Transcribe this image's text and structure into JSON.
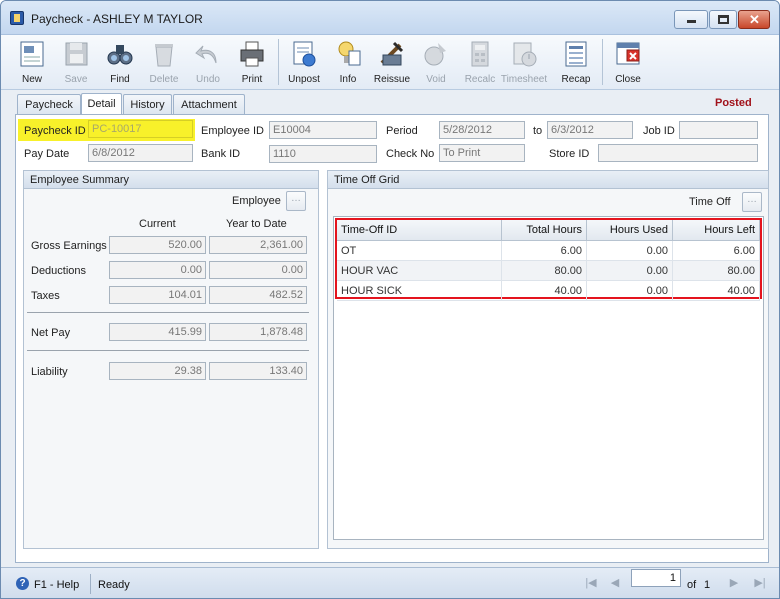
{
  "window": {
    "title": "Paycheck - ASHLEY M TAYLOR",
    "status": "Posted"
  },
  "toolbar": {
    "new": "New",
    "save": "Save",
    "find": "Find",
    "delete": "Delete",
    "undo": "Undo",
    "print": "Print",
    "unpost": "Unpost",
    "info": "Info",
    "reissue": "Reissue",
    "void": "Void",
    "recalc": "Recalc",
    "timesheet": "Timesheet",
    "recap": "Recap",
    "close": "Close"
  },
  "tabs": [
    "Paycheck",
    "Detail",
    "History",
    "Attachment"
  ],
  "header": {
    "paycheck_id_label": "Paycheck ID",
    "paycheck_id": "PC-10017",
    "employee_id_label": "Employee ID",
    "employee_id": "E10004",
    "period_label": "Period",
    "period_start": "5/28/2012",
    "to_label": "to",
    "period_end": "6/3/2012",
    "job_id_label": "Job ID",
    "job_id": "",
    "pay_date_label": "Pay Date",
    "pay_date": "6/8/2012",
    "bank_id_label": "Bank ID",
    "bank_id": "1110",
    "check_no_label": "Check No",
    "check_no": "To Print",
    "store_id_label": "Store ID",
    "store_id": ""
  },
  "summary": {
    "title": "Employee Summary",
    "employee_label": "Employee",
    "current_label": "Current",
    "ytd_label": "Year to Date",
    "rows": [
      {
        "label": "Gross Earnings",
        "current": "520.00",
        "ytd": "2,361.00"
      },
      {
        "label": "Deductions",
        "current": "0.00",
        "ytd": "0.00"
      },
      {
        "label": "Taxes",
        "current": "104.01",
        "ytd": "482.52"
      },
      {
        "label": "Net Pay",
        "current": "415.99",
        "ytd": "1,878.48"
      },
      {
        "label": "Liability",
        "current": "29.38",
        "ytd": "133.40"
      }
    ]
  },
  "timeoff": {
    "title": "Time Off Grid",
    "timeoff_label": "Time Off",
    "columns": [
      "Time-Off ID",
      "Total Hours",
      "Hours Used",
      "Hours Left"
    ],
    "rows": [
      [
        "OT",
        "6.00",
        "0.00",
        "6.00"
      ],
      [
        "HOUR VAC",
        "80.00",
        "0.00",
        "80.00"
      ],
      [
        "HOUR SICK",
        "40.00",
        "0.00",
        "40.00"
      ]
    ]
  },
  "status": {
    "help": "F1 - Help",
    "ready": "Ready",
    "page": "1",
    "of_label": "of",
    "total_pages": "1"
  },
  "colors": {
    "highlight": "#f8f12a",
    "grid_border": "#e4141e",
    "posted": "#a1121b"
  }
}
